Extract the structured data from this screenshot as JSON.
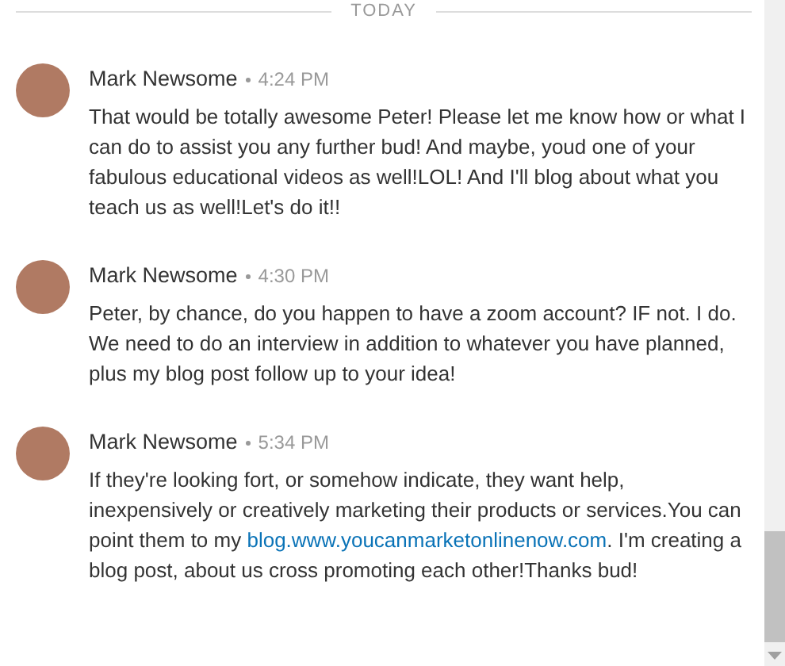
{
  "divider": {
    "label": "TODAY"
  },
  "messages": [
    {
      "sender": "Mark Newsome",
      "time": "4:24 PM",
      "body": [
        {
          "kind": "text",
          "text": "That would be totally awesome Peter! Please let me know how or what I can do to assist you any further bud! And maybe, youd one of your fabulous educational videos as well!LOL! And I'll blog about what you teach us as well!Let's do it!!"
        }
      ]
    },
    {
      "sender": "Mark Newsome",
      "time": "4:30 PM",
      "body": [
        {
          "kind": "text",
          "text": "Peter, by chance, do you happen to have a zoom account? IF not. I do. We need to do an interview in addition to whatever you have planned, plus my blog post follow up to your idea!"
        }
      ]
    },
    {
      "sender": "Mark Newsome",
      "time": "5:34 PM",
      "body": [
        {
          "kind": "text",
          "text": "If they're looking fort, or somehow indicate, they want help, inexpensively or creatively marketing their products or services.You can point them to my "
        },
        {
          "kind": "link",
          "text": "blog.www.youcanmarketonlinenow.com"
        },
        {
          "kind": "text",
          "text": ". I'm creating a blog post, about us cross promoting each other!Thanks bud!"
        }
      ]
    }
  ]
}
